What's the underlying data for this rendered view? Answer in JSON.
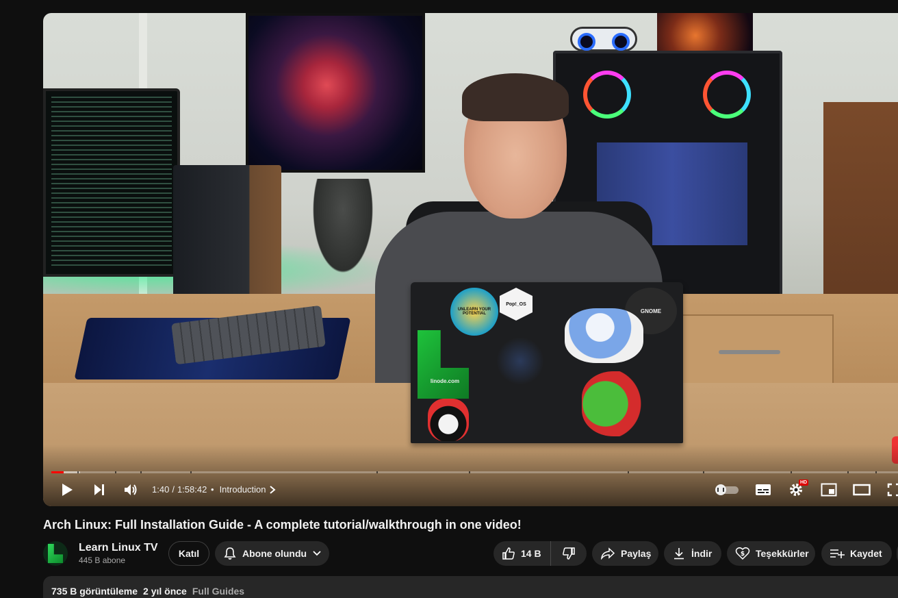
{
  "player": {
    "time_current": "1:40",
    "time_separator": "/",
    "time_total": "1:58:42",
    "chapter_label": "Introduction",
    "progress_played": 0.0143,
    "progress_buffered": 0.034,
    "hd_badge": "HD",
    "sticker_linode": "linode.com",
    "sticker_pop": "Pop!_OS",
    "sticker_gnome": "GNOME",
    "sticker_unlearn": "UNLEARN YOUR POTENTIAL"
  },
  "video": {
    "title": "Arch Linux: Full Installation Guide - A complete tutorial/walkthrough in one video!"
  },
  "channel": {
    "name": "Learn Linux TV",
    "subscribers": "445 B abone"
  },
  "actions": {
    "join_label": "Katıl",
    "subscribe_label": "Abone olundu",
    "like_count": "14 B",
    "share_label": "Paylaş",
    "download_label": "İndir",
    "thanks_label": "Teşekkürler",
    "save_label": "Kaydet"
  },
  "description": {
    "views": "735 B görüntüleme",
    "age": "2 yıl önce",
    "tag": "Full Guides"
  },
  "colors": {
    "accent": "#ff0000",
    "background": "#0f0f0f",
    "pill": "#272727"
  }
}
